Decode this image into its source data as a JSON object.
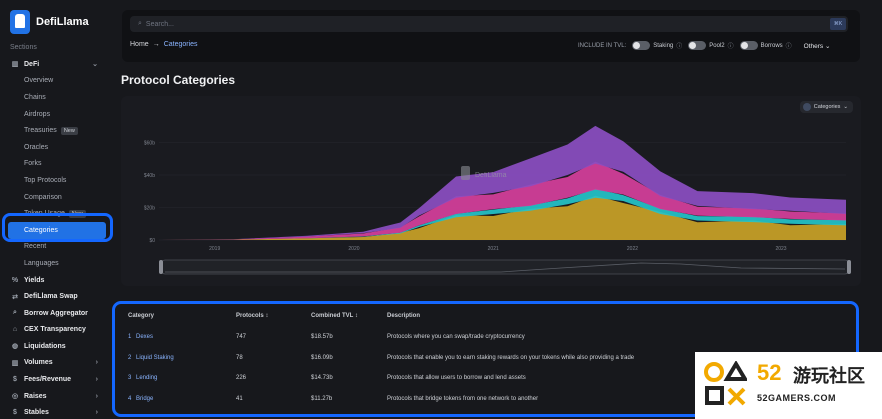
{
  "app": {
    "name": "DefiLlama"
  },
  "sidebar": {
    "section_label": "Sections",
    "items": [
      {
        "label": "DeFi",
        "icon": "bar-chart-icon",
        "kind": "top",
        "chevron": "⌄"
      },
      {
        "label": "Overview",
        "kind": "sub"
      },
      {
        "label": "Chains",
        "kind": "sub"
      },
      {
        "label": "Airdrops",
        "kind": "sub"
      },
      {
        "label": "Treasuries",
        "kind": "sub",
        "badge": "New"
      },
      {
        "label": "Oracles",
        "kind": "sub"
      },
      {
        "label": "Forks",
        "kind": "sub"
      },
      {
        "label": "Top Protocols",
        "kind": "sub"
      },
      {
        "label": "Comparison",
        "kind": "sub"
      },
      {
        "label": "Token Usage",
        "kind": "sub",
        "badge": "New"
      },
      {
        "label": "Categories",
        "kind": "sub",
        "active": true
      },
      {
        "label": "Recent",
        "kind": "sub"
      },
      {
        "label": "Languages",
        "kind": "sub"
      },
      {
        "label": "Yields",
        "icon": "percent-icon",
        "kind": "top"
      },
      {
        "label": "DefiLlama Swap",
        "icon": "swap-icon",
        "kind": "top"
      },
      {
        "label": "Borrow Aggregator",
        "icon": "search-icon",
        "kind": "top"
      },
      {
        "label": "CEX Transparency",
        "icon": "bank-icon",
        "kind": "top"
      },
      {
        "label": "Liquidations",
        "icon": "droplet-icon",
        "kind": "top"
      },
      {
        "label": "Volumes",
        "icon": "bar-chart-icon",
        "kind": "top",
        "chevron": "›"
      },
      {
        "label": "Fees/Revenue",
        "icon": "dollar-icon",
        "kind": "top",
        "chevron": "›"
      },
      {
        "label": "Raises",
        "icon": "coins-icon",
        "kind": "top",
        "chevron": "›"
      },
      {
        "label": "Stables",
        "icon": "dollar-icon",
        "kind": "top",
        "chevron": "›"
      }
    ]
  },
  "search": {
    "placeholder": "Search...",
    "shortcut": "⌘K"
  },
  "breadcrumb": {
    "home": "Home",
    "separator": "→",
    "current": "Categories"
  },
  "include_tvl": {
    "label": "INCLUDE IN TVL:",
    "toggles": [
      "Staking",
      "Pool2",
      "Borrows"
    ],
    "others": "Others"
  },
  "page": {
    "title": "Protocol Categories"
  },
  "chart_data": {
    "type": "area",
    "title": "",
    "y_ticks": [
      "$60b",
      "$40b",
      "$20b",
      "$0"
    ],
    "x_ticks": [
      "2019",
      "2020",
      "2021",
      "2022",
      "2023"
    ],
    "ylim": [
      0,
      80
    ],
    "selector_label": "Categories",
    "watermark": "DefiLlama",
    "x": [
      2019.6,
      2020.0,
      2020.4,
      2020.7,
      2020.9,
      2021.0,
      2021.2,
      2021.4,
      2021.6,
      2021.8,
      2021.95,
      2022.1,
      2022.3,
      2022.5,
      2022.8,
      2023.0,
      2023.3
    ],
    "series": [
      {
        "name": "Dexes",
        "color": "#c9a227",
        "values": [
          0,
          0.2,
          1,
          2,
          4,
          8,
          14,
          16,
          18,
          22,
          26,
          24,
          16,
          12,
          11,
          10,
          9
        ]
      },
      {
        "name": "Liquid Staking",
        "color": "#24c3c9",
        "values": [
          0,
          0,
          0.1,
          0.2,
          0.5,
          1,
          2,
          3,
          3,
          4,
          5,
          4,
          3,
          3,
          3,
          3,
          3
        ]
      },
      {
        "name": "Lending",
        "color": "#d63f9c",
        "values": [
          0,
          0.2,
          1,
          2,
          3,
          6,
          10,
          10,
          12,
          14,
          16,
          14,
          8,
          6,
          5,
          5,
          4
        ]
      },
      {
        "name": "Bridge",
        "color": "#8b4ec2",
        "values": [
          0,
          0.1,
          0.5,
          1,
          3,
          5,
          12,
          14,
          16,
          20,
          22,
          20,
          14,
          10,
          9,
          9,
          8
        ]
      }
    ]
  },
  "table": {
    "headers": [
      "Category",
      "Protocols ↕",
      "Combined TVL ↕",
      "Description"
    ],
    "rows": [
      {
        "rank": "1",
        "name": "Dexes",
        "protocols": "747",
        "tvl": "$18.57b",
        "description": "Protocols where you can swap/trade cryptocurrency"
      },
      {
        "rank": "2",
        "name": "Liquid Staking",
        "protocols": "78",
        "tvl": "$16.09b",
        "description": "Protocols that enable you to earn staking rewards on your tokens while also providing a trade"
      },
      {
        "rank": "3",
        "name": "Lending",
        "protocols": "226",
        "tvl": "$14.73b",
        "description": "Protocols that allow users to borrow and lend assets"
      },
      {
        "rank": "4",
        "name": "Bridge",
        "protocols": "41",
        "tvl": "$11.27b",
        "description": "Protocols that bridge tokens from one network to another"
      }
    ]
  },
  "watermark": {
    "number": "52",
    "cn": "游玩社区",
    "url": "52GAMERS.COM"
  }
}
